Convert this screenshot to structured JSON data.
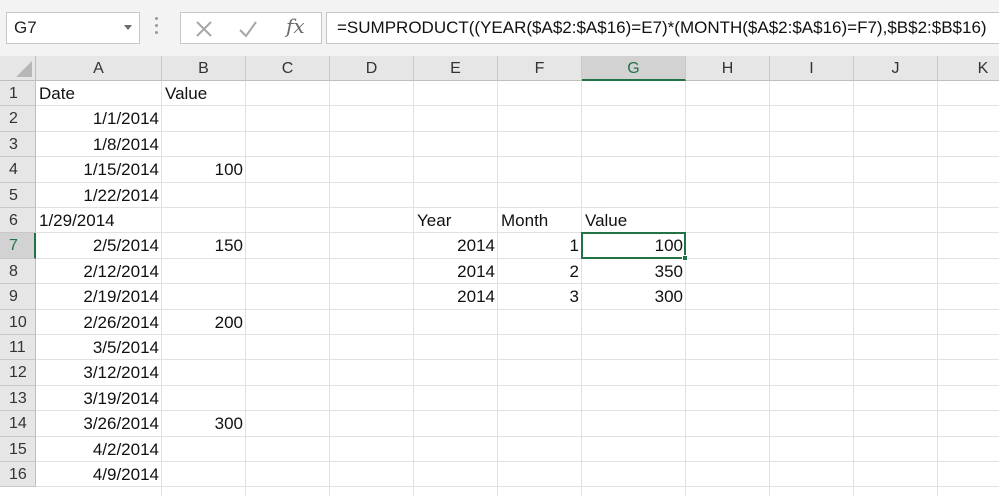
{
  "name_box": {
    "value": "G7"
  },
  "formula_bar": {
    "formula": "=SUMPRODUCT((YEAR($A$2:$A$16)=E7)*(MONTH($A$2:$A$16)=F7),$B$2:$B$16)",
    "fx_label": "fx"
  },
  "sheet": {
    "selected_cell": "G7",
    "columns": [
      "A",
      "B",
      "C",
      "D",
      "E",
      "F",
      "G",
      "H",
      "I",
      "J",
      "K"
    ],
    "rows": [
      "1",
      "2",
      "3",
      "4",
      "5",
      "6",
      "7",
      "8",
      "9",
      "10",
      "11",
      "12",
      "13",
      "14",
      "15",
      "16"
    ],
    "cells": {
      "A1": "Date",
      "B1": "Value",
      "A2": "1/1/2014",
      "A3": "1/8/2014",
      "A4": "1/15/2014",
      "B4": "100",
      "A5": "1/22/2014",
      "A6": "1/29/2014",
      "E6": "Year",
      "F6": "Month",
      "G6": "Value",
      "A7": "2/5/2014",
      "B7": "150",
      "E7": "2014",
      "F7": "1",
      "G7": "100",
      "A8": "2/12/2014",
      "E8": "2014",
      "F8": "2",
      "G8": "350",
      "A9": "2/19/2014",
      "E9": "2014",
      "F9": "3",
      "G9": "300",
      "A10": "2/26/2014",
      "B10": "200",
      "A11": "3/5/2014",
      "A12": "3/12/2014",
      "A13": "3/19/2014",
      "A14": "3/26/2014",
      "B14": "300",
      "A15": "4/2/2014",
      "A16": "4/9/2014"
    }
  },
  "colors": {
    "accent": "#217346",
    "header_bg": "#e6e6e6",
    "gridline": "#e1e1e1"
  }
}
